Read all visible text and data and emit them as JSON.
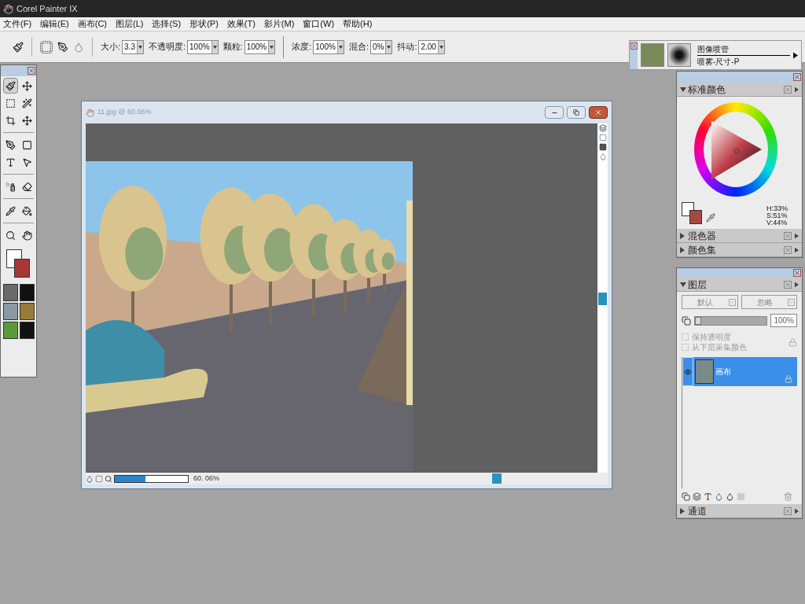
{
  "window": {
    "title": "Corel Painter IX"
  },
  "menu": [
    "文件(F)",
    "编辑(E)",
    "画布(C)",
    "图层(L)",
    "选择(S)",
    "形状(P)",
    "效果(T)",
    "影片(M)",
    "窗口(W)",
    "帮助(H)"
  ],
  "property_bar": {
    "fields": [
      {
        "label": "大小:",
        "value": "3.3"
      },
      {
        "label": "不透明度:",
        "value": "100%"
      },
      {
        "label": "颗粒:",
        "value": "100%"
      },
      {
        "label": "浓度:",
        "value": "100%"
      },
      {
        "label": "混合:",
        "value": "0%"
      },
      {
        "label": "抖动:",
        "value": "2.00"
      }
    ]
  },
  "brush_selector": {
    "category": "图像喷管",
    "variant": "喷雾-尺寸-P"
  },
  "toolbox": {
    "tools": [
      {
        "selected": true
      },
      {
        "selected": false
      },
      {
        "selected": false
      },
      {
        "selected": false
      },
      {
        "selected": false
      },
      {
        "selected": false
      },
      {
        "selected": false
      },
      {
        "selected": false
      },
      {
        "selected": false
      },
      {
        "selected": false
      },
      {
        "selected": false
      },
      {
        "selected": false
      },
      {
        "selected": false
      },
      {
        "selected": false
      },
      {
        "selected": false
      },
      {
        "selected": false
      }
    ]
  },
  "document": {
    "title": "11.jpg @ 60.06%",
    "zoom": "60. 06%",
    "zoom_slider": {
      "level": 0.42
    }
  },
  "color_panel": {
    "title": "标准颜色",
    "expanded": true,
    "readings": [
      "H:33%",
      "S:51%",
      "V:44%"
    ]
  },
  "collapsed_panels": [
    {
      "title": "混色器",
      "expanded": false
    },
    {
      "title": "颜色集",
      "expanded": false
    }
  ],
  "layers_panel": {
    "title": "图层",
    "expanded": true,
    "composite_method": "默认",
    "composite_depth": "忽略",
    "opacity": "100%",
    "opacity_slider": {
      "level": 0.0
    },
    "options": [
      {
        "label": "保持透明度",
        "checked": false,
        "disabled": true
      },
      {
        "label": "从下层采集颜色",
        "checked": false,
        "disabled": true
      }
    ],
    "layers": [
      {
        "name": "画布",
        "selected": true,
        "visible": true
      }
    ]
  },
  "channels_panel": {
    "title": "通道",
    "expanded": false
  }
}
